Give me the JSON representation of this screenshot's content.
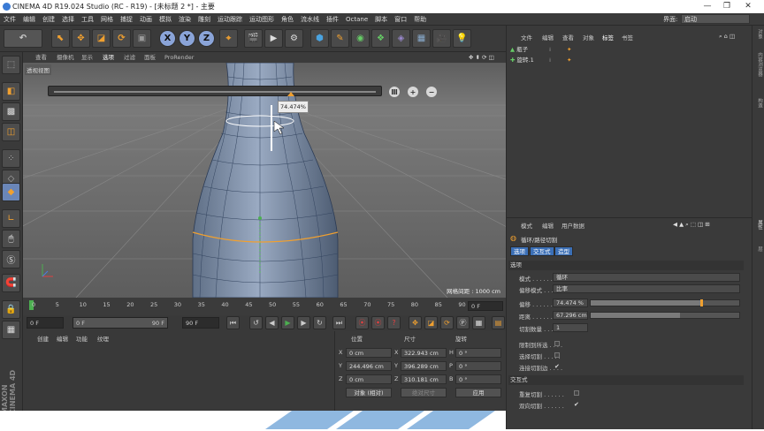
{
  "title_bar": {
    "title": "CINEMA 4D R19.024 Studio (RC - R19) - [未标题 2 *] - 主要",
    "minimize": "—",
    "maximize": "❐",
    "close": "✕"
  },
  "menu": {
    "items": [
      "文件",
      "编辑",
      "创建",
      "选择",
      "工具",
      "网格",
      "捕捉",
      "动画",
      "模拟",
      "渲染",
      "雕刻",
      "运动跟踪",
      "运动图形",
      "角色",
      "流水线",
      "插件",
      "Octane",
      "脚本",
      "窗口",
      "帮助"
    ],
    "layout_label": "界面:",
    "layout_value": "启动"
  },
  "toolbar": {
    "axis_x": "X",
    "axis_y": "Y",
    "axis_z": "Z",
    "icons": [
      "undo-icon",
      "select-icon",
      "move-icon",
      "scale-icon",
      "rotate-icon",
      "object-icon",
      "coord-icon",
      "render-view-icon",
      "render-picture-icon",
      "render-settings-icon",
      "cube-icon",
      "pen-icon",
      "subdivision-icon",
      "cloner-icon",
      "deformer-icon",
      "floor-icon",
      "camera-icon",
      "light-icon"
    ]
  },
  "viewport": {
    "menu": [
      "查看",
      "摄像机",
      "显示",
      "选项",
      "过滤",
      "面板",
      "ProRender"
    ],
    "label": "透视视图",
    "grid_spacing": "网格间距 : 1000 cm",
    "slider_tooltip": "74.474%",
    "slider_fraction": 0.74
  },
  "timeline": {
    "ticks": [
      "0",
      "5",
      "10",
      "15",
      "20",
      "25",
      "30",
      "35",
      "40",
      "45",
      "50",
      "55",
      "60",
      "65",
      "70",
      "75",
      "80",
      "85",
      "90"
    ],
    "end_frame": "0 F",
    "current": "0 F",
    "start": "0 F",
    "range_end": "90 F",
    "max": "90 F"
  },
  "materials": {
    "menu": [
      "创建",
      "编辑",
      "功能",
      "纹理"
    ]
  },
  "coordinates": {
    "headers": [
      "位置",
      "尺寸",
      "旋转"
    ],
    "rows": [
      {
        "axis": "X",
        "pos": "0 cm",
        "size_axis": "X",
        "size": "322.943 cm",
        "rot_axis": "H",
        "rot": "0 °"
      },
      {
        "axis": "Y",
        "pos": "244.496 cm",
        "size_axis": "Y",
        "size": "396.289 cm",
        "rot_axis": "P",
        "rot": "0 °"
      },
      {
        "axis": "Z",
        "pos": "0 cm",
        "size_axis": "Z",
        "size": "310.181 cm",
        "rot_axis": "B",
        "rot": "0 °"
      }
    ],
    "mode": "对象 (相对)",
    "size_mode": "绝对尺寸",
    "apply": "应用"
  },
  "objects": {
    "menu": [
      "文件",
      "编辑",
      "查看",
      "对象",
      "标签",
      "书签"
    ],
    "rows": [
      {
        "name": "瓶子"
      },
      {
        "name": "旋转.1"
      }
    ]
  },
  "attributes": {
    "menu": [
      "模式",
      "编辑",
      "用户数据"
    ],
    "tool_title": "循环/路径切割",
    "tabs": [
      "选项",
      "交互式",
      "造型"
    ],
    "section_options": "选项",
    "mode_label": "模式 . . . . . . . . .",
    "mode_value": "循环",
    "offset_mode_label": "偏移模式 . . . . .",
    "offset_mode_value": "比率",
    "offset_label": "偏移 . . . . . . . . .",
    "offset_value": "74.474 %",
    "offset_fraction": 0.74,
    "distance_label": "距离 . . . . . . . . .",
    "distance_value": "67.296 cm",
    "distance_fraction": 0.6,
    "cuts_label": "切割数量 . . . . . .",
    "cuts_value": "1",
    "limit_label": "限制到所选 . . . .",
    "select_cuts_label": "选择切割 . . . . .",
    "connect_label": "连接切割边 . . . .",
    "section_interactive": "交互式",
    "resample_label": "重复切割 . . . . . .",
    "bidirectional_label": "双向切割 . . . . . ."
  },
  "side_tabs": [
    "对象",
    "内容浏览器",
    "构造",
    "属性",
    "层"
  ],
  "brand": "MAXON CINEMA 4D"
}
